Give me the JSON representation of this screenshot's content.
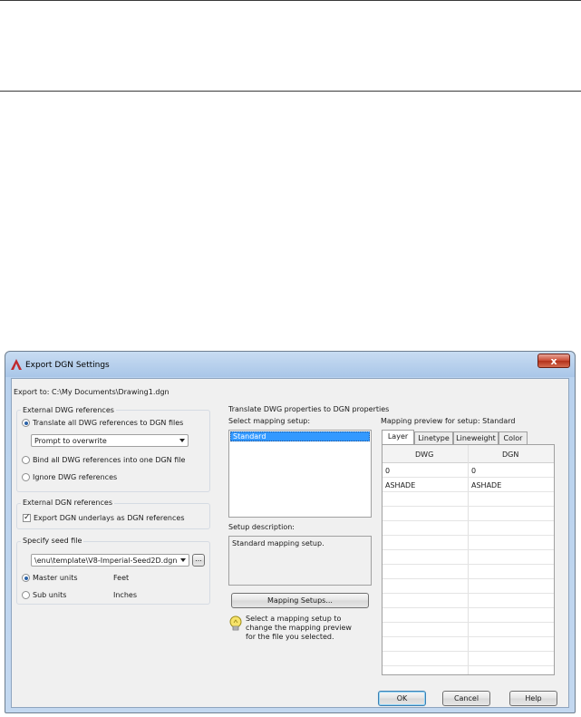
{
  "window": {
    "title": "Export DGN Settings",
    "close_label": "x"
  },
  "export_to": "Export to: C:\\My Documents\\Drawing1.dgn",
  "external_dwg": {
    "title": "External DWG references",
    "options": [
      {
        "label": "Translate all DWG references to DGN files",
        "selected": true
      },
      {
        "label": "Bind all DWG references into one DGN file",
        "selected": false
      },
      {
        "label": "Ignore DWG references",
        "selected": false
      }
    ],
    "overwrite_select": "Prompt to overwrite"
  },
  "external_dgn": {
    "title": "External DGN references",
    "checkbox_label": "Export DGN underlays as DGN references",
    "checked": true
  },
  "seed_file": {
    "title": "Specify seed file",
    "path": "\\enu\\template\\V8-Imperial-Seed2D.dgn",
    "browse_label": "...",
    "units": [
      {
        "label": "Master units",
        "value": "Feet",
        "selected": true
      },
      {
        "label": "Sub units",
        "value": "Inches",
        "selected": false
      }
    ]
  },
  "translate": {
    "title": "Translate DWG properties to DGN properties",
    "select_label": "Select mapping setup:",
    "setups": [
      "Standard"
    ],
    "description_label": "Setup description:",
    "description": "Standard mapping setup.",
    "mapping_button": "Mapping Setups...",
    "hint": [
      "Select a mapping setup to",
      "change the mapping preview",
      "for the file you selected."
    ]
  },
  "preview": {
    "title": "Mapping preview for setup: Standard",
    "tabs": [
      "Layer",
      "Linetype",
      "Lineweight",
      "Color"
    ],
    "columns": [
      "DWG",
      "DGN"
    ],
    "rows": [
      [
        "0",
        "0"
      ],
      [
        "ASHADE",
        "ASHADE"
      ]
    ]
  },
  "buttons": {
    "ok": "OK",
    "cancel": "Cancel",
    "help": "Help"
  },
  "colors": {
    "selection": "#3399ff",
    "title_gradient": "#b9d2ee",
    "close": "#c94a33"
  }
}
